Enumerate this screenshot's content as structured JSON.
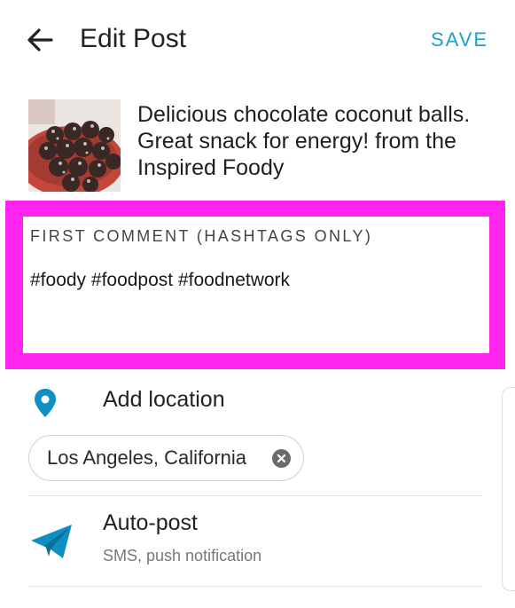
{
  "header": {
    "title": "Edit Post",
    "save_label": "SAVE"
  },
  "post": {
    "caption": "Delicious chocolate coconut balls. Great snack for energy! from the Inspired Foody"
  },
  "comment": {
    "label": "FIRST COMMENT (HASHTAGS ONLY)",
    "text": "#foody #foodpost #foodnetwork"
  },
  "location": {
    "label": "Add location",
    "chip": "Los Angeles, California"
  },
  "autopost": {
    "label": "Auto-post",
    "subtitle": "SMS, push notification"
  },
  "colors": {
    "accent": "#1aa3c9",
    "highlight": "#ff24f0",
    "icon_blue": "#0f8fc4"
  },
  "icons": [
    "back-arrow-icon",
    "location-pin-icon",
    "close-circle-icon",
    "paper-plane-icon"
  ]
}
